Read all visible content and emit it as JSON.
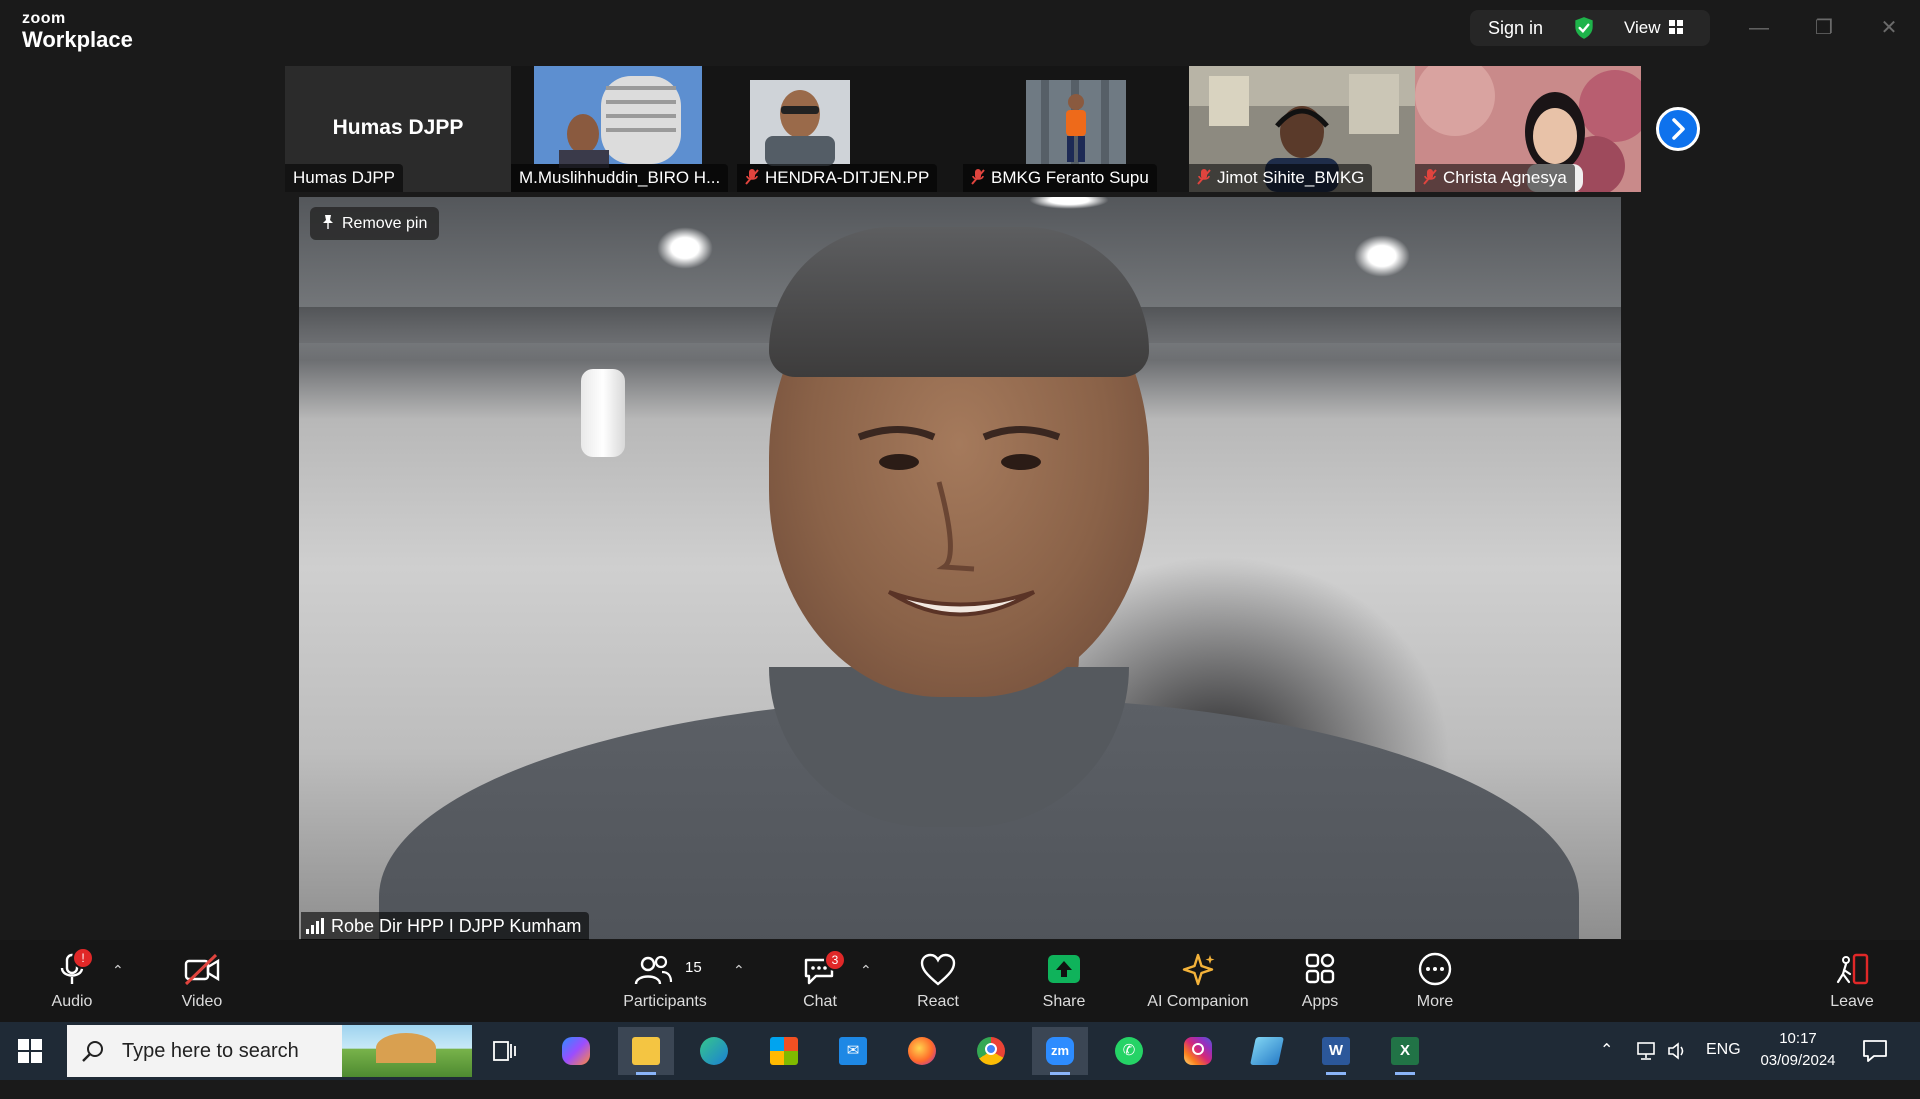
{
  "window": {
    "brand_top": "zoom",
    "brand_bottom": "Workplace",
    "sign_in": "Sign in",
    "view": "View"
  },
  "strip": {
    "tiles": [
      {
        "name": "Humas DJPP",
        "center_name": "Humas DJPP",
        "muted": false
      },
      {
        "name": "M.Muslihhuddin_BIRO H...",
        "muted": false
      },
      {
        "name": "HENDRA-DITJEN.PP",
        "muted": true
      },
      {
        "name": "BMKG Feranto Supu",
        "muted": true
      },
      {
        "name": "Jimot Sihite_BMKG",
        "muted": true
      },
      {
        "name": "Christa Agnesya",
        "muted": true
      }
    ]
  },
  "main": {
    "remove_pin": "Remove pin",
    "speaker_name": "Robe Dir HPP I DJPP Kumham"
  },
  "toolbar": {
    "audio": "Audio",
    "audio_badge": "!",
    "video": "Video",
    "participants": "Participants",
    "participants_count": "15",
    "chat": "Chat",
    "chat_badge": "3",
    "react": "React",
    "share": "Share",
    "ai_companion": "AI Companion",
    "apps": "Apps",
    "more": "More",
    "leave": "Leave"
  },
  "taskbar": {
    "search_placeholder": "Type here to search",
    "language": "ENG",
    "time": "10:17",
    "date": "03/09/2024",
    "apps": [
      "task-view",
      "copilot",
      "file-explorer",
      "edge",
      "microsoft-store",
      "mail",
      "firefox",
      "chrome",
      "zoom",
      "whatsapp",
      "instagram",
      "notepad",
      "word",
      "excel"
    ]
  },
  "colors": {
    "accent_blue": "#0e72ed",
    "share_green": "#0fb35b",
    "leave_red": "#e02828",
    "muted_red": "#e0443e"
  }
}
